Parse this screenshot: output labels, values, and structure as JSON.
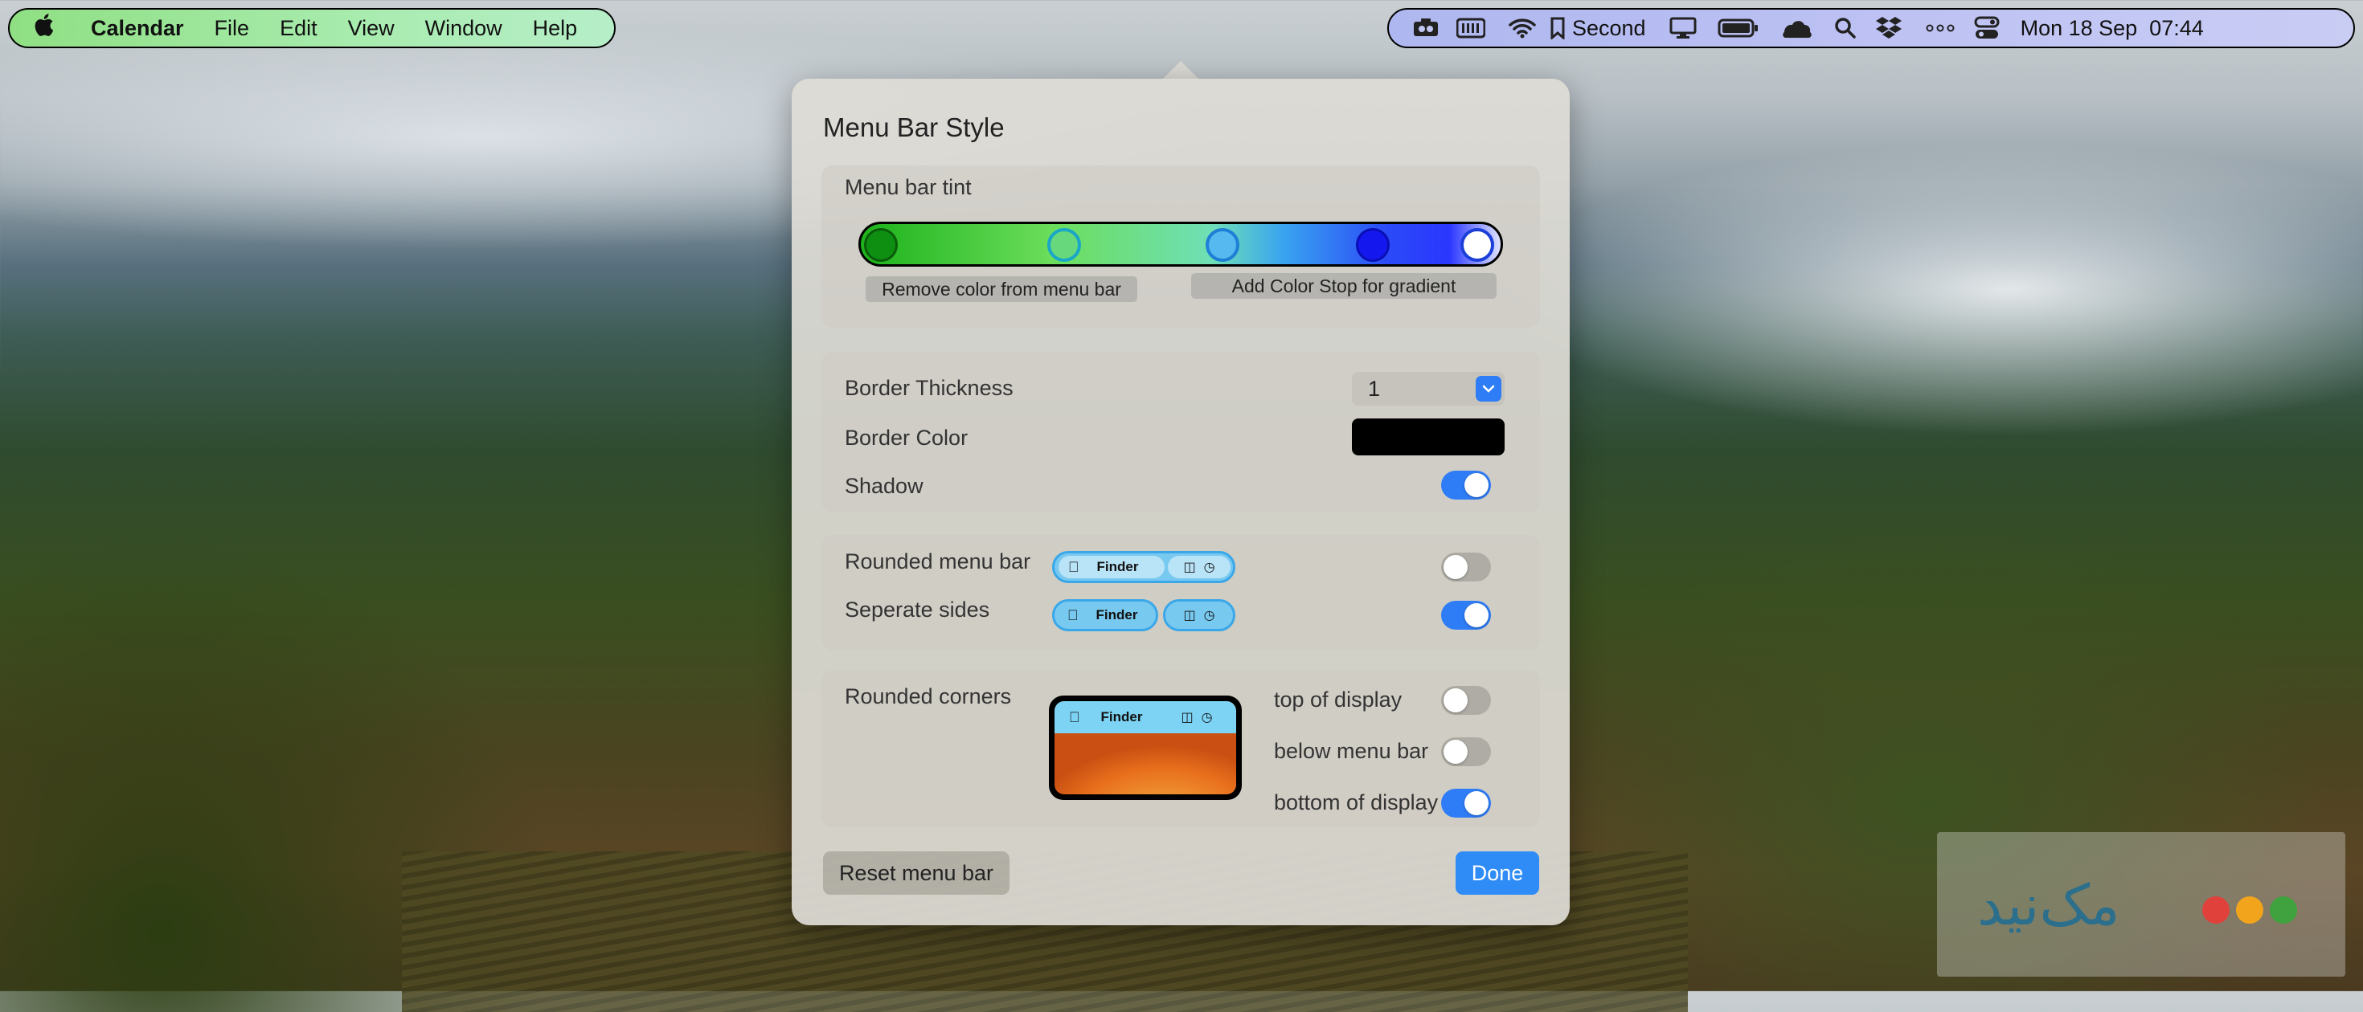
{
  "menubar_left": {
    "app": "Calendar",
    "menus": [
      "File",
      "Edit",
      "View",
      "Window",
      "Help"
    ]
  },
  "menubar_right": {
    "display_name": "Second",
    "datetime": "Mon 18 Sep  07:44",
    "icons": [
      "camera-icon",
      "keyboard-icon",
      "wifi-icon",
      "bookmark-icon",
      "display-icon",
      "battery-icon",
      "cloud-icon",
      "search-icon",
      "dropbox-icon",
      "more-icon",
      "control-center-icon"
    ]
  },
  "dialog": {
    "title": "Menu Bar Style",
    "tint": {
      "label": "Menu bar tint",
      "stops": [
        "#0e8f12",
        "#5fd47a",
        "#56b8ee",
        "#1418ee",
        "#ffffff"
      ],
      "remove_btn": "Remove color from menu bar",
      "add_btn": "Add Color Stop for gradient"
    },
    "border": {
      "thickness_label": "Border Thickness",
      "thickness_value": "1",
      "color_label": "Border Color",
      "color_value": "#000000",
      "shadow_label": "Shadow",
      "shadow_on": true
    },
    "shape": {
      "rounded_label": "Rounded menu bar",
      "rounded_on": false,
      "separate_label": "Seperate sides",
      "separate_on": true,
      "preview_app": "Finder"
    },
    "corners": {
      "label": "Rounded corners",
      "preview_app": "Finder",
      "top_label": "top of display",
      "top_on": false,
      "below_label": "below menu bar",
      "below_on": false,
      "bottom_label": "bottom of display",
      "bottom_on": true
    },
    "reset_btn": "Reset menu bar",
    "done_btn": "Done"
  },
  "watermark": {
    "text": "مک‌نید"
  },
  "colors": {
    "accent": "#2f7df6",
    "dialog_bg": "#dedcd5"
  }
}
